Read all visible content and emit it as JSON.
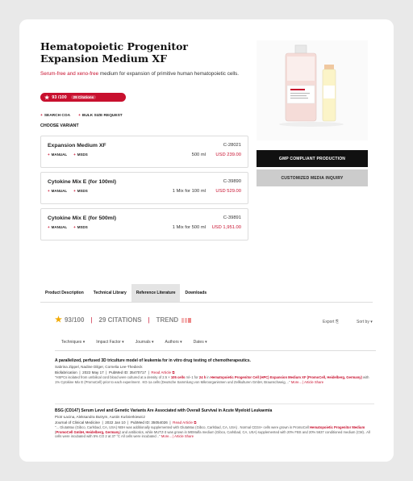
{
  "product": {
    "title": "Hematopoietic Progenitor Expansion Medium XF",
    "subtitle_highlight": "Serum-free and xeno-free",
    "subtitle_rest": " medium for expansion of primitive human hematopoietic cells.",
    "score": "93 /100",
    "citations": "29 Citations"
  },
  "links": {
    "search_coa": "SEARCH COA",
    "bulk": "BULK SIZE REQUEST"
  },
  "choose_label": "CHOOSE VARIANT",
  "variants": [
    {
      "name": "Expansion Medium XF",
      "code": "C-28021",
      "manual": "MANUAL",
      "msds": "MSDS",
      "size": "500 ml",
      "price": "USD 239.00"
    },
    {
      "name": "Cytokine Mix E (for 100ml)",
      "code": "C-39890",
      "manual": "MANUAL",
      "msds": "MSDS",
      "size": "1 Mix for 100 ml",
      "price": "USD 529.00"
    },
    {
      "name": "Cytokine Mix E (for 500ml)",
      "code": "C-39891",
      "manual": "MANUAL",
      "msds": "MSDS",
      "size": "1 Mix for 500 ml",
      "price": "USD 1,951.00"
    }
  ],
  "buttons": {
    "gmp": "GMP COMPLIANT PRODUCTION",
    "custom": "CUSTOMIZED MEDIA INQUIRY"
  },
  "tabs": [
    "Product Description",
    "Technical Library",
    "Reference Literature",
    "Downloads"
  ],
  "stats": {
    "score": "93/100",
    "citations": "29 CITATIONS",
    "trend": "TREND"
  },
  "export_label": "Export",
  "sort_label": "Sort by",
  "filters": [
    "Techniques",
    "Impact Factor",
    "Journals",
    "Authors",
    "Dates"
  ],
  "articles": [
    {
      "title": "A parallelized, perfused 3D triculture model of leukemia for in vitro drug testing of chemotherapeutics.",
      "authors": "Sabrina Zippel, Nadine Dilger, Cornelia Lee-Thedieck",
      "journal": "Biofabrication",
      "date": "2022 May 17",
      "pmid": "PubMed ID: 35470717",
      "read": "Read Article",
      "snip_a": "\"HSPCs isolated from umbilical cord blood were cultured at a density of 2.5 × ",
      "snip_b": "105 cells",
      "snip_c": " ml−1 for ",
      "snip_d": "24 h",
      "snip_e": " in ",
      "snip_f": "Hematopoietic Progenitor Cell (HPC) Expansion Medium XF (PromoCell, Heidelberg, Germany)",
      "snip_g": " with 1% Cytokine Mix E (PromoCell) prior to each experiment . KG-1a cells (Deutsche Sammlung von Mikroorganismen und Zellkulturen GmbH, Braunschweig, ..\" ",
      "more": "More... | Article Share"
    },
    {
      "title": "BSG (CD147) Serum Level and Genetic Variants Are Associated with Overall Survival in Acute Myeloid Leukaemia",
      "authors": "Piotr Łacina, Aleksandra Butrym, Austin Kuśnierkiewicz",
      "journal": "Journal of Clinical Medicine",
      "date": "2022 Jan 10",
      "pmid": "PubMed ID: 35054026",
      "read": "Read Article",
      "snip_a": "\"... GlutaMax (Gibco, Carlsbad, CA, USA) NBH was additionally supplemented with GlutaMax (Gibco, Carlsbad, CA, USA) . Normal CD34+ cells were grown in PromoCell ",
      "snip_b": "Hematopoietic Progenitor Medium",
      "snip_c": " (",
      "snip_d": "PromoCell GmbH, Heidelberg, Germany",
      "snip_e": ") and antibiotics, while MUTZ-3 was grown in MEMalfa medium (Gibco, Carlsbad, CA, USA) supplemented with 20% FBS and 20% 5637 conditioned medium (CM).. All cells were incubated with 5% CO 2 at 37 °C All cells were incubated ..\" ",
      "snip_f": "",
      "snip_g": "",
      "more": "More... | Article Share"
    }
  ]
}
